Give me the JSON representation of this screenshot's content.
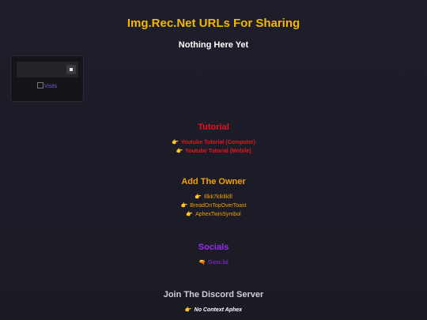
{
  "header": {
    "title": "Img.Rec.Net URLs For Sharing",
    "subtitle": "Nothing Here Yet"
  },
  "widget": {
    "image_alt": "Visits"
  },
  "tutorial": {
    "heading": "Tutorial",
    "links": [
      "Youtube Tutorial (Computer)",
      "Youtube Tutorial (Mobile)"
    ]
  },
  "owner": {
    "heading": "Add The Owner",
    "links": [
      "Illkk7klkllklll",
      "BreadOnTopOverToast",
      "AphexTwinSymbol"
    ]
  },
  "socials": {
    "heading": "Socials",
    "links": [
      "Guns.lol"
    ]
  },
  "discord": {
    "heading": "Join The Discord Server",
    "links": [
      "No Context Aphex"
    ]
  },
  "icons": {
    "pointer": "👉",
    "gun": "🔫"
  },
  "colors": {
    "background": "#1d1d29",
    "title": "#f5b800",
    "tutorial": "#e8141c",
    "owner": "#f0a000",
    "socials": "#9a2bf0"
  }
}
